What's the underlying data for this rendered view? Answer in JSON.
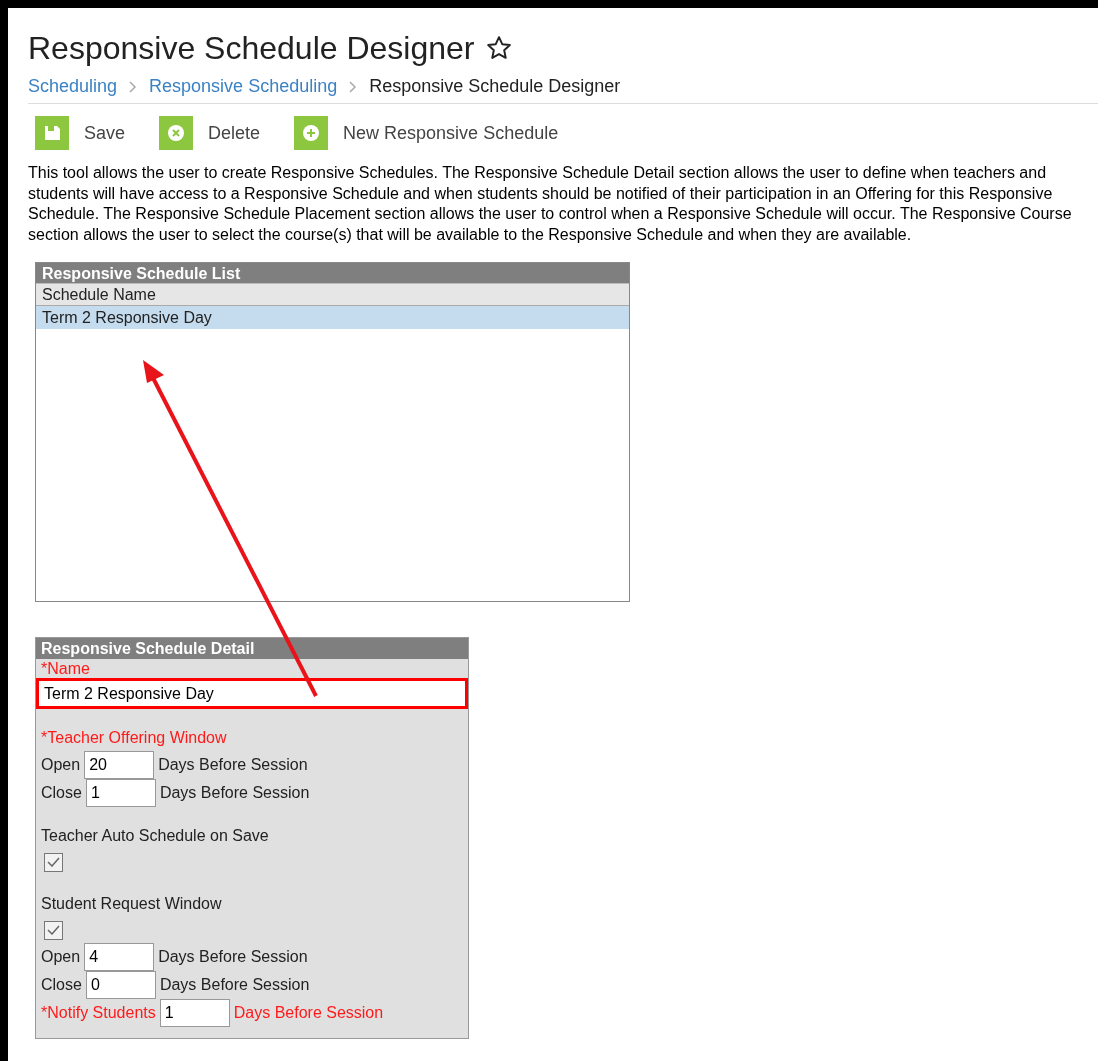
{
  "page": {
    "title": "Responsive Schedule Designer",
    "favorite": false
  },
  "breadcrumb": [
    {
      "label": "Scheduling",
      "link": true
    },
    {
      "label": "Responsive Scheduling",
      "link": true
    },
    {
      "label": "Responsive Schedule Designer",
      "link": false
    }
  ],
  "toolbar": [
    {
      "kind": "save",
      "label": "Save"
    },
    {
      "kind": "delete",
      "label": "Delete"
    },
    {
      "kind": "new",
      "label": "New Responsive Schedule"
    }
  ],
  "description": "This tool allows the user to create Responsive Schedules. The Responsive Schedule Detail section allows the user to define when teachers and students will have access to a Responsive Schedule and when students should be notified of their participation in an Offering for this Responsive Schedule. The Responsive Schedule Placement section allows the user to control when a Responsive Schedule will occur. The Responsive Course section allows the user to select the course(s) that will be available to the Responsive Schedule and when they are available.",
  "schedule_list": {
    "title": "Responsive Schedule List",
    "column": "Schedule Name",
    "rows": [
      {
        "name": "Term 2 Responsive Day",
        "selected": true
      }
    ]
  },
  "detail": {
    "title": "Responsive Schedule Detail",
    "name_label": "*Name",
    "name_value": "Term 2 Responsive Day",
    "name_highlighted": true,
    "items": [
      {
        "kind": "gap"
      },
      {
        "kind": "heading",
        "label": "*Teacher Offering Window",
        "required": true
      },
      {
        "kind": "days",
        "label": "Open",
        "value": "20",
        "suffix": "Days Before Session",
        "required": false
      },
      {
        "kind": "days",
        "label": "Close",
        "value": "1",
        "suffix": "Days Before Session",
        "required": false
      },
      {
        "kind": "gap"
      },
      {
        "kind": "heading",
        "label": "Teacher Auto Schedule on Save",
        "required": false
      },
      {
        "kind": "checkbox",
        "checked": true
      },
      {
        "kind": "gap"
      },
      {
        "kind": "heading",
        "label": "Student Request Window",
        "required": false
      },
      {
        "kind": "checkbox",
        "checked": true
      },
      {
        "kind": "days",
        "label": "Open",
        "value": "4",
        "suffix": "Days Before Session",
        "required": false
      },
      {
        "kind": "days",
        "label": "Close",
        "value": "0",
        "suffix": "Days Before Session",
        "required": false
      },
      {
        "kind": "days",
        "label": "*Notify Students",
        "value": "1",
        "suffix": "Days Before Session",
        "required": true
      }
    ]
  }
}
